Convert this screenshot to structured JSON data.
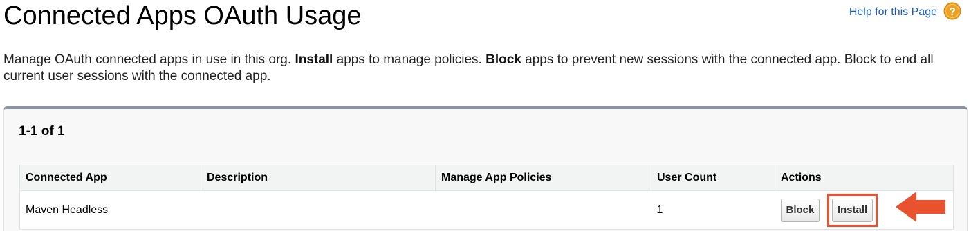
{
  "header": {
    "title": "Connected Apps OAuth Usage",
    "help_link": "Help for this Page"
  },
  "description": {
    "part1": "Manage OAuth connected apps in use in this org. ",
    "install_word": "Install",
    "part2": " apps to manage policies. ",
    "block_word": "Block",
    "part3": " apps to prevent new sessions with the connected app. Block to end all current user sessions with the connected app."
  },
  "list": {
    "record_count": "1-1 of 1",
    "columns": [
      "Connected App",
      "Description",
      "Manage App Policies",
      "User Count",
      "Actions"
    ],
    "rows": [
      {
        "connected_app": "Maven Headless",
        "description": "",
        "manage_app_policies": "",
        "user_count": "1",
        "block_label": "Block",
        "install_label": "Install"
      }
    ]
  },
  "colors": {
    "accent_highlight": "#e8522e",
    "link": "#1a5cc0",
    "help_icon": "#f0a020",
    "panel_border": "#8a93a6"
  },
  "icons": {
    "help": "question-mark-icon",
    "annotation": "arrow-left-icon"
  }
}
